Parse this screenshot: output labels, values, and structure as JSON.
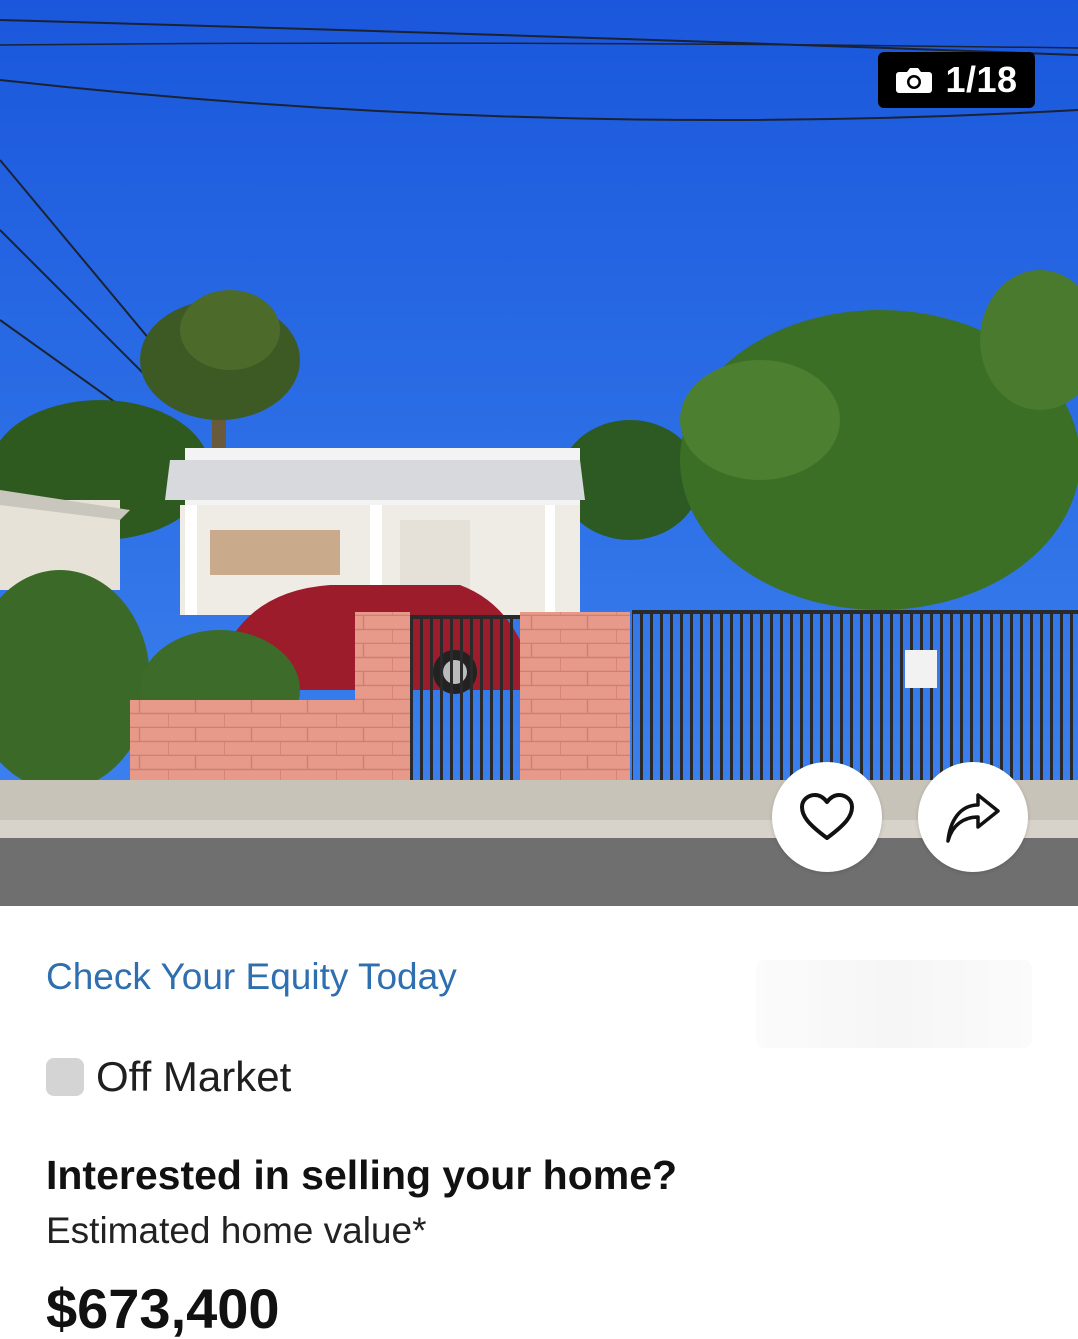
{
  "hero": {
    "image_alt": "House exterior",
    "photo_counter": {
      "icon": "camera-icon",
      "text": "1/18"
    },
    "favorite_button": {
      "icon": "heart-icon"
    },
    "share_button": {
      "icon": "share-arrow-icon"
    }
  },
  "equity_link": "Check Your Equity Today",
  "status": {
    "label": "Off Market",
    "dot_color": "#d4d4d4"
  },
  "sell": {
    "heading": "Interested in selling your home?",
    "estimate_label": "Estimated home value*",
    "estimate_value": "$673,400"
  },
  "colors": {
    "link": "#2f6fb0",
    "sky": "#1f5fe0"
  }
}
